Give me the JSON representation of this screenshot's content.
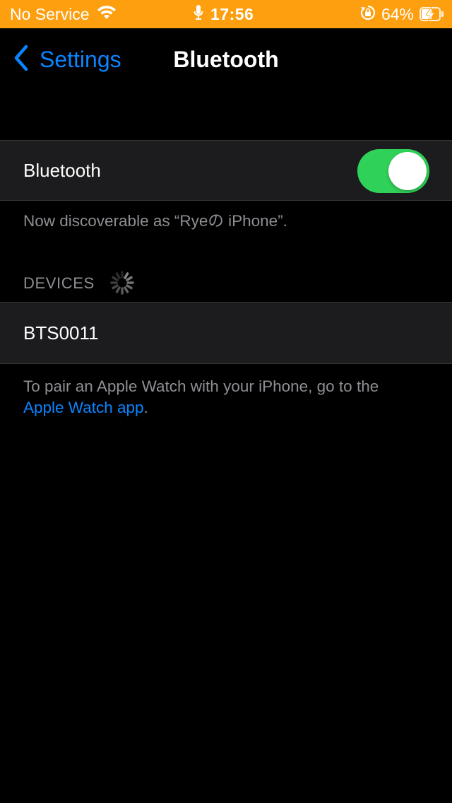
{
  "status_bar": {
    "carrier": "No Service",
    "time": "17:56",
    "battery_percent": "64%",
    "battery_level": 0.64,
    "charging": true,
    "background_color": "#fd9f0f",
    "icons": [
      "wifi-icon",
      "microphone-icon",
      "rotation-lock-icon",
      "battery-charging-icon"
    ]
  },
  "nav": {
    "back_label": "Settings",
    "title": "Bluetooth"
  },
  "bluetooth_cell": {
    "label": "Bluetooth",
    "toggle_on": true,
    "toggle_color": "#30d158"
  },
  "discoverable_text": "Now discoverable as “Ryeの iPhone”.",
  "devices_section": {
    "header": "DEVICES",
    "searching": true,
    "items": [
      {
        "name": "BTS0011"
      }
    ]
  },
  "apple_watch_footer": {
    "text_before": "To pair an Apple Watch with your iPhone, go to the",
    "link_text": "Apple Watch app",
    "text_after": "."
  },
  "colors": {
    "accent": "#0a84ff",
    "background": "#000000",
    "cell_background": "#1c1c1e",
    "secondary_text": "#8e8e93"
  }
}
